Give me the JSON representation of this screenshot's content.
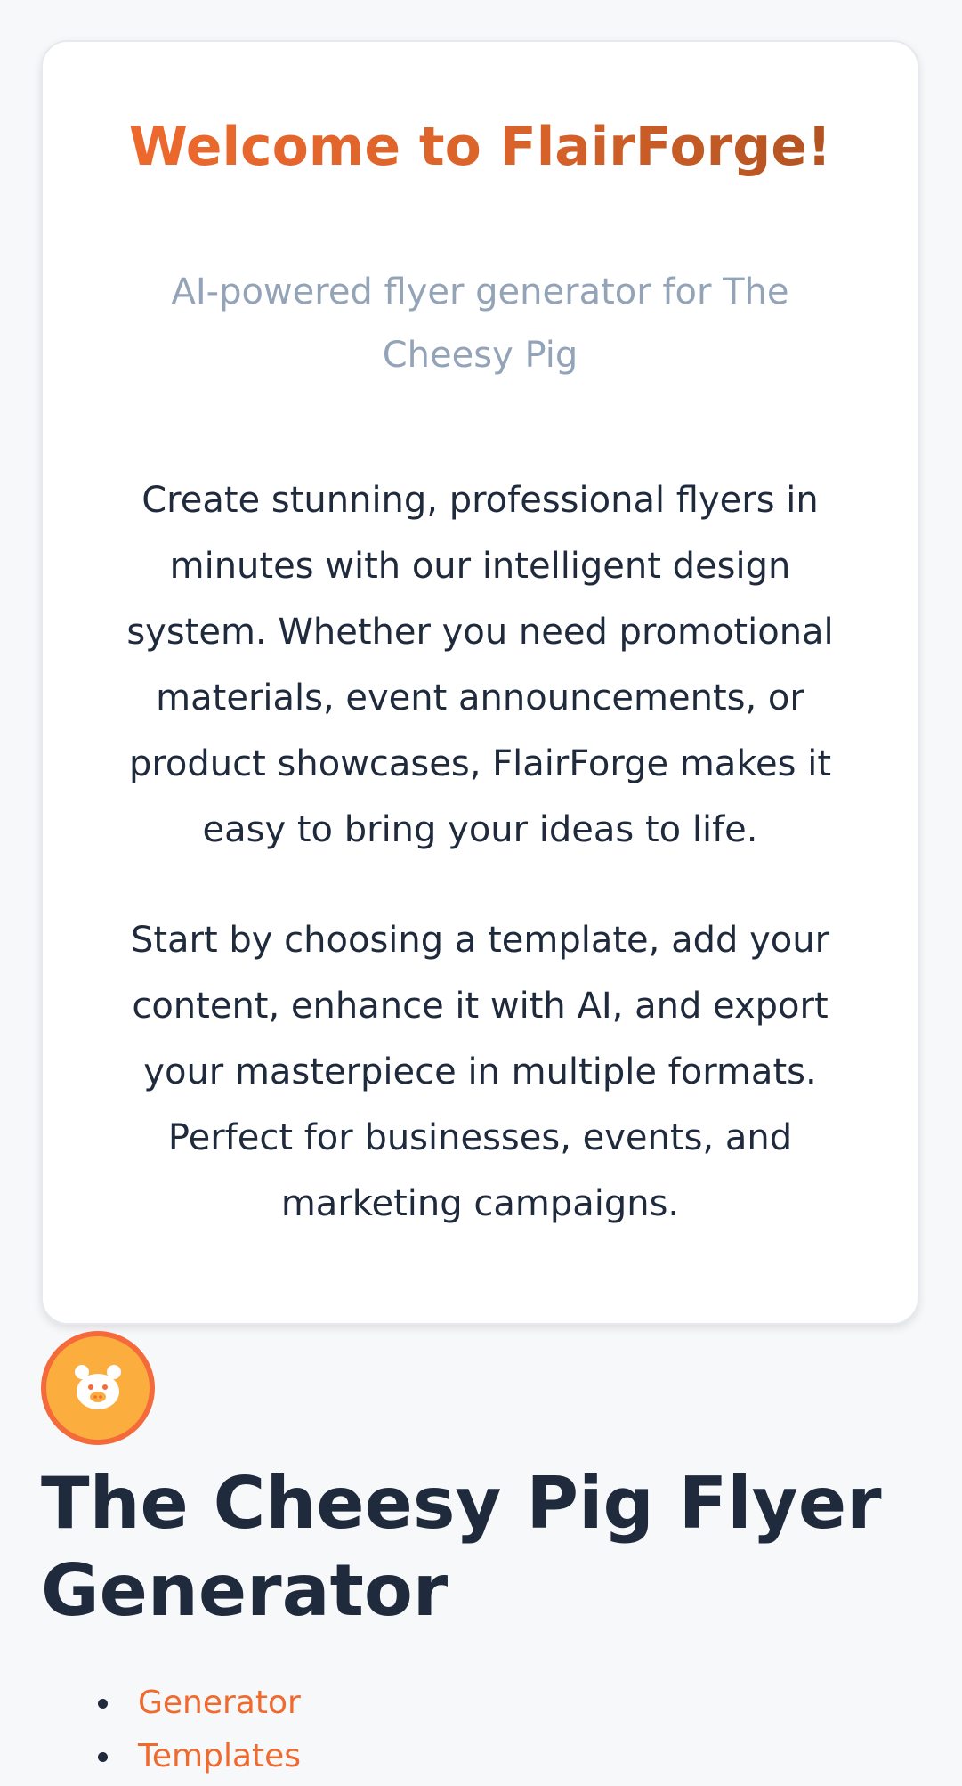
{
  "welcome": {
    "title": "Welcome to FlairForge!",
    "subtitle": "AI-powered flyer generator for The Cheesy Pig",
    "paragraph1": "Create stunning, professional flyers in minutes with our intelligent design system. Whether you need promotional materials, event announcements, or product showcases, FlairForge makes it easy to bring your ideas to life.",
    "paragraph2": "Start by choosing a template, add your content, enhance it with AI, and export your masterpiece in multiple formats. Perfect for businesses, events, and marketing campaigns."
  },
  "header": {
    "logo_icon": "pig-face-icon",
    "title": "The Cheesy Pig Flyer Generator"
  },
  "nav": {
    "items": [
      {
        "label": "Generator"
      },
      {
        "label": "Templates"
      }
    ]
  },
  "colors": {
    "accent": "#f06a2f",
    "logo_fill": "#fbae3d",
    "logo_ring": "#f46a3b",
    "text": "#1f2a3d",
    "muted": "#93a3b8",
    "background": "#f7f8fa"
  }
}
